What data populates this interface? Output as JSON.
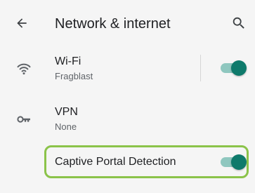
{
  "app_bar": {
    "title": "Network & internet"
  },
  "settings": {
    "wifi": {
      "title": "Wi-Fi",
      "summary": "Fragblast",
      "enabled": true
    },
    "vpn": {
      "title": "VPN",
      "summary": "None"
    },
    "captive_portal": {
      "title": "Captive Portal Detection",
      "enabled": true
    }
  },
  "colors": {
    "switch_thumb_on": "#0e7a6b",
    "switch_track_on": "#8fc7bf",
    "highlight": "#8bc34a",
    "background": "#f5f5f5"
  },
  "icons": {
    "back": "back-arrow-icon",
    "search": "search-icon",
    "wifi": "wifi-icon",
    "vpn": "vpn-key-icon"
  }
}
